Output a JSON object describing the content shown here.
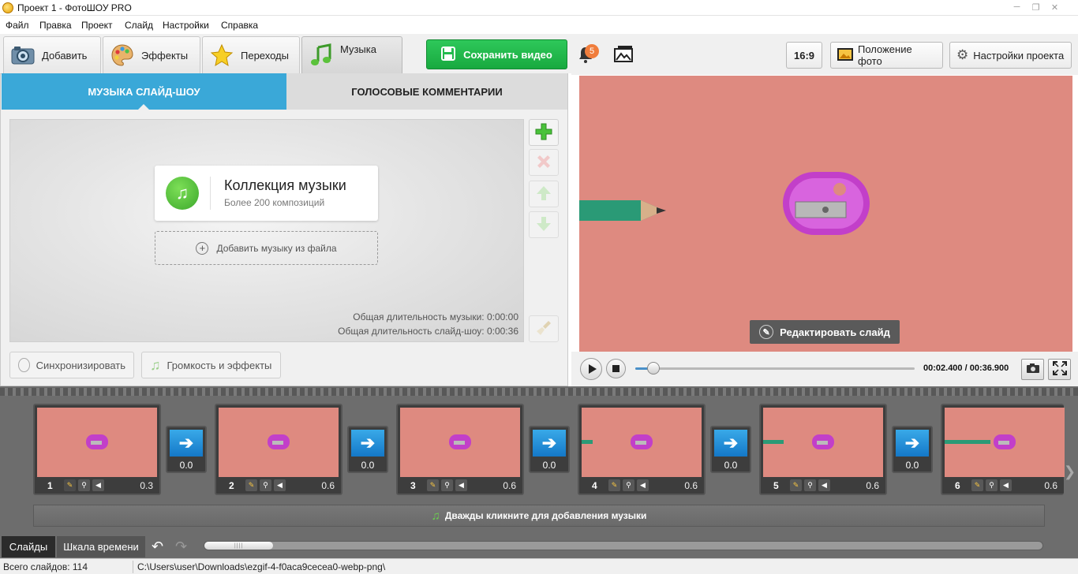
{
  "window": {
    "title": "Проект 1 - ФотоШОУ PRO",
    "controls": [
      "minimize-icon",
      "restore-icon",
      "close-icon"
    ]
  },
  "menu": [
    "Файл",
    "Правка",
    "Проект",
    "Слайд",
    "Настройки",
    "Справка"
  ],
  "tabs": [
    {
      "label": "Добавить",
      "icon": "camera-icon"
    },
    {
      "label": "Эффекты",
      "icon": "palette-icon"
    },
    {
      "label": "Переходы",
      "icon": "star-icon"
    },
    {
      "label": "Музыка",
      "icon": "music-note-icon",
      "active": true
    }
  ],
  "save_button": "Сохранить видео",
  "notifications": {
    "count": "5"
  },
  "right_toolbar": {
    "aspect": "16:9",
    "photo_position": "Положение фото",
    "project_settings": "Настройки проекта"
  },
  "music_panel": {
    "tab_slideshow_music": "МУЗЫКА СЛАЙД-ШОУ",
    "tab_voice_comments": "ГОЛОСОВЫЕ КОММЕНТАРИИ",
    "collection_title": "Коллекция музыки",
    "collection_subtitle": "Более 200 композиций",
    "add_from_file": "Добавить музыку из файла",
    "music_duration": "Общая длительность музыки: 0:00:00",
    "slideshow_duration": "Общая длительность слайд-шоу: 0:00:36",
    "sync_button": "Синхронизировать",
    "volume_button": "Громкость и эффекты"
  },
  "preview": {
    "edit_slide": "Редактировать слайд",
    "time": "00:02.400 / 00:36.900",
    "progress": 0.065
  },
  "slides": [
    {
      "num": "1",
      "duration": "0.3",
      "pencil": false
    },
    {
      "num": "2",
      "duration": "0.6",
      "pencil": false
    },
    {
      "num": "3",
      "duration": "0.6",
      "pencil": false
    },
    {
      "num": "4",
      "duration": "0.6",
      "pencil": true
    },
    {
      "num": "5",
      "duration": "0.6",
      "pencil": true
    },
    {
      "num": "6",
      "duration": "0.6",
      "pencil": true
    }
  ],
  "transitions": [
    "0.0",
    "0.0",
    "0.0",
    "0.0",
    "0.0"
  ],
  "music_strip": "Дважды кликните для добавления музыки",
  "bottom_tabs": {
    "slides": "Слайды",
    "timeline": "Шкала времени"
  },
  "status": {
    "total_slides": "Всего слайдов: 114",
    "path": "C:\\Users\\user\\Downloads\\ezgif-4-f0aca9cecea0-webp-png\\"
  },
  "colors": {
    "accent_blue": "#3aa8d8",
    "save_green": "#18a93f",
    "slide_background": "#de8a80",
    "sharpener": "#c23fc9"
  }
}
